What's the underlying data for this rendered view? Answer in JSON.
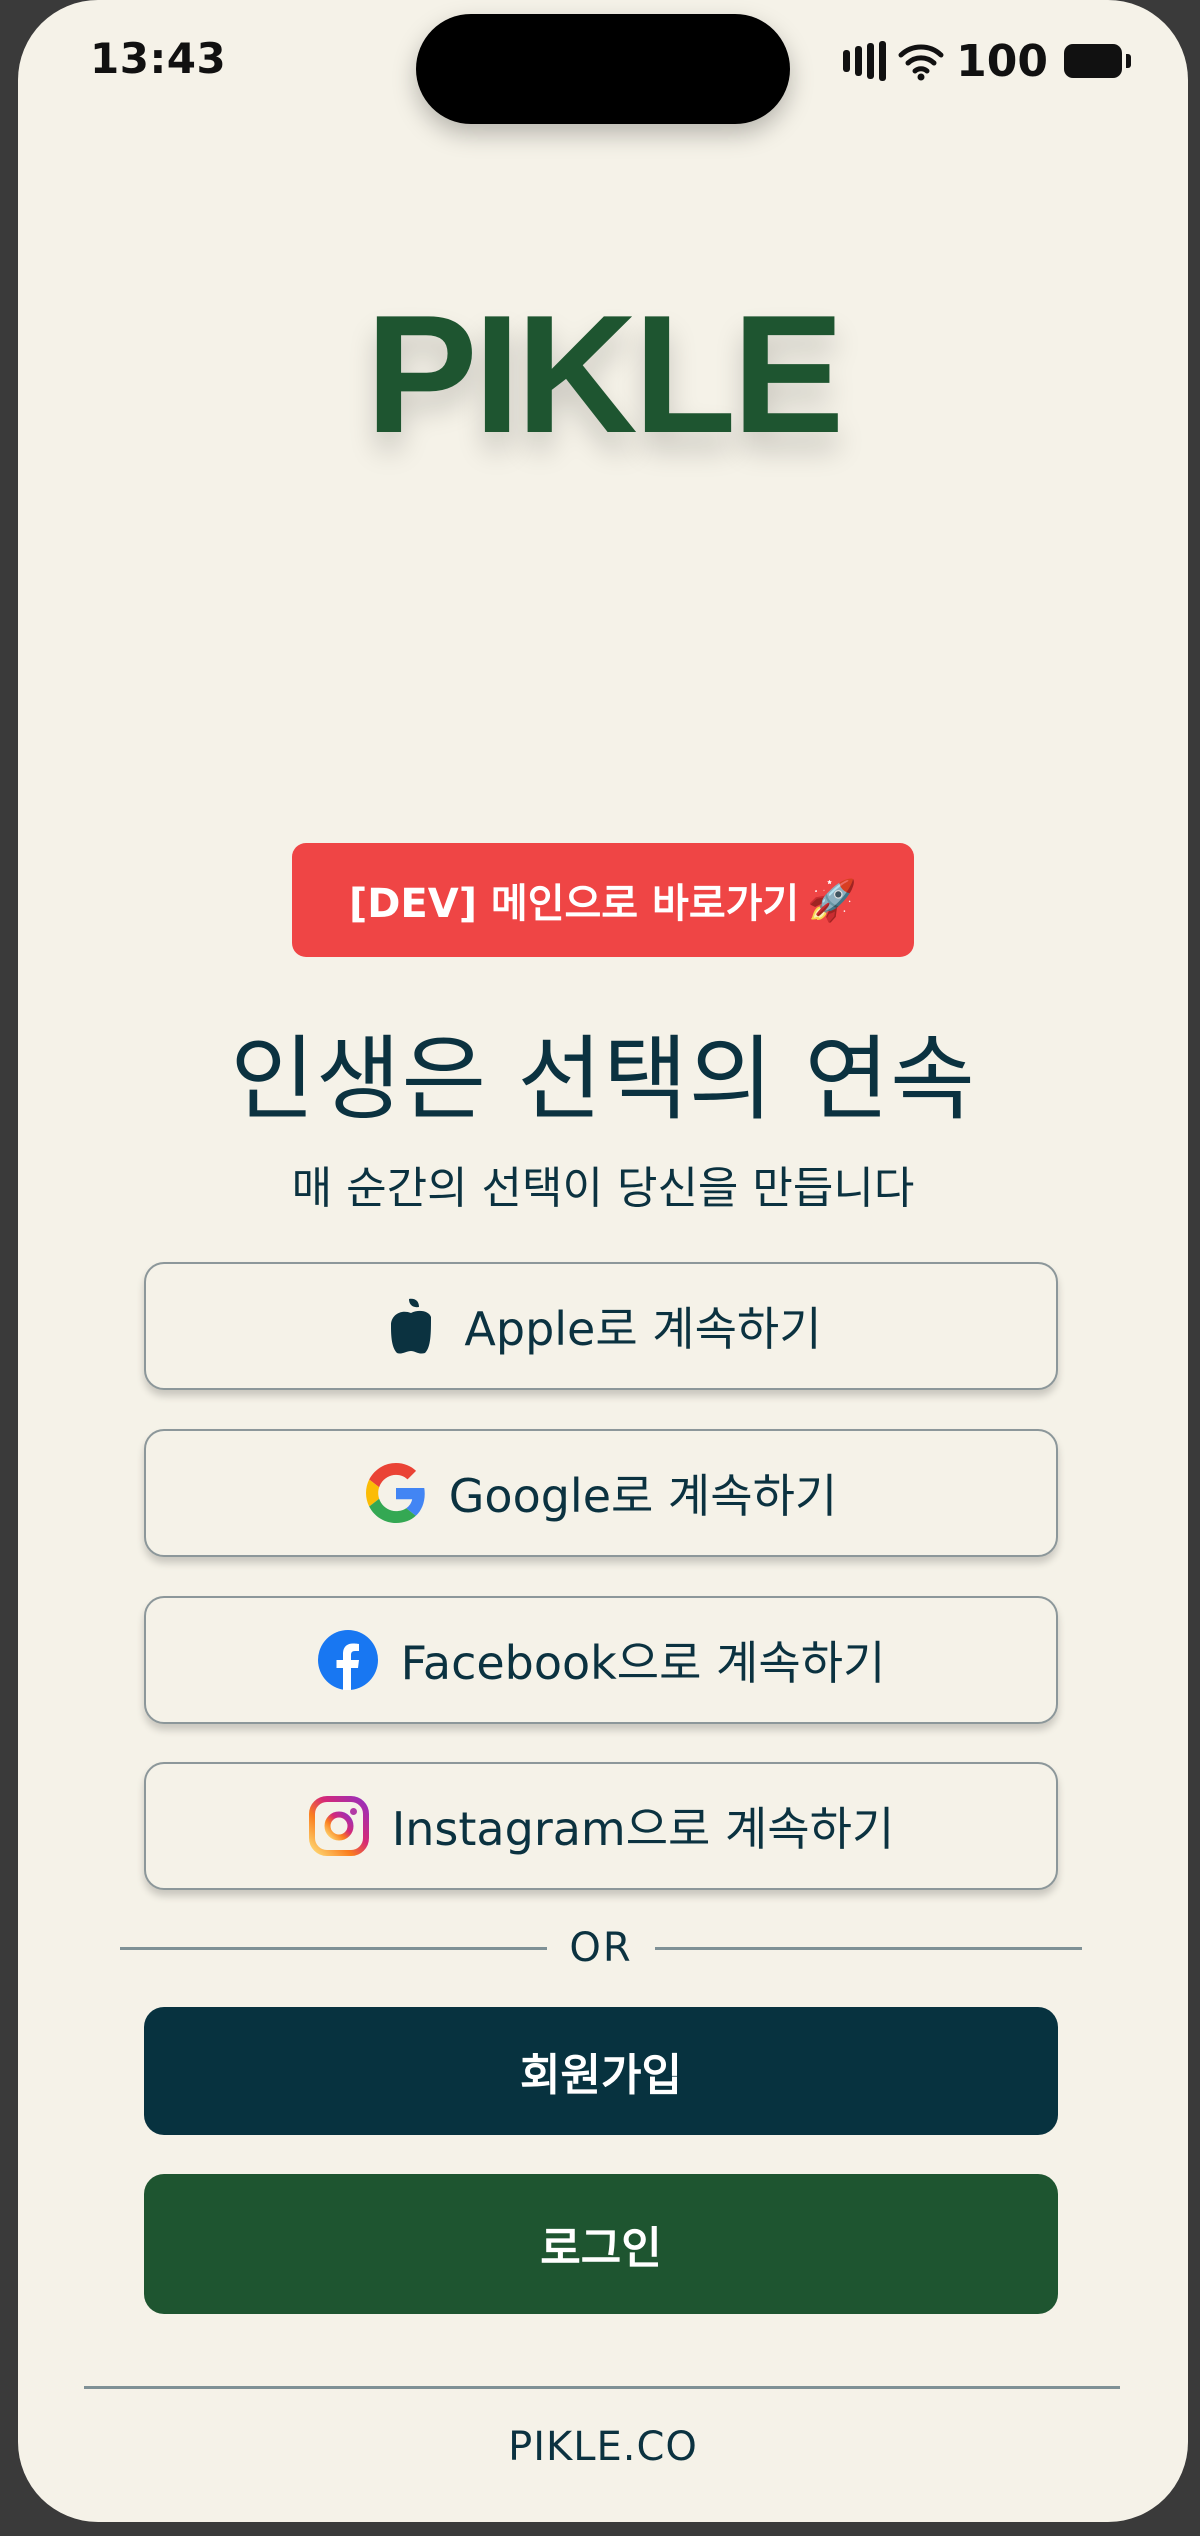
{
  "status_bar": {
    "time": "13:43",
    "battery": "100"
  },
  "app": {
    "logo": "PIKLE"
  },
  "dev": {
    "label": "[DEV] 메인으로 바로가기",
    "emoji": "🚀"
  },
  "hero": {
    "headline": "인생은 선택의 연속",
    "subtitle": "매 순간의 선택이 당신을 만듭니다"
  },
  "social": {
    "apple": "Apple로 계속하기",
    "google": "Google로 계속하기",
    "facebook": "Facebook으로 계속하기",
    "instagram": "Instagram으로 계속하기"
  },
  "divider": {
    "text": "OR"
  },
  "actions": {
    "signup": "회원가입",
    "login": "로그인"
  },
  "footer": {
    "text": "PIKLE.CO"
  },
  "colors": {
    "background": "#f5f2e8",
    "brand_green": "#1e5530",
    "dark_teal": "#07323f",
    "dev_red": "#ef4545",
    "facebook_blue": "#1877f2"
  }
}
